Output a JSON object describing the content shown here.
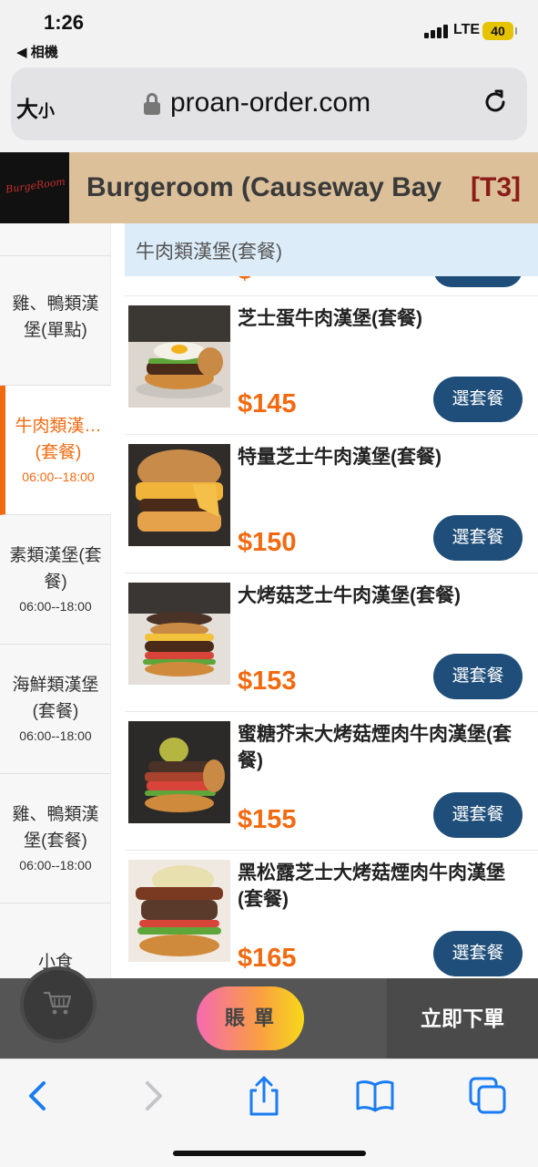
{
  "status_bar": {
    "time": "1:26",
    "back_app": "◀ 相機",
    "network": "LTE",
    "battery": "40"
  },
  "browser": {
    "text_size_label": "大",
    "text_size_label_small": "小",
    "url": "proan-order.com"
  },
  "header": {
    "logo_text": "BurgeRoom",
    "shop_name": "Burgeroom (Causeway Bay",
    "table": "[T3]"
  },
  "sidebar": {
    "items": [
      {
        "name": "雞、鴨類漢堡(單點)",
        "hours": ""
      },
      {
        "name": "牛肉類漢…(套餐)",
        "hours": "06:00--18:00",
        "active": true
      },
      {
        "name": "素類漢堡(套餐)",
        "hours": "06:00--18:00"
      },
      {
        "name": "海鮮類漢堡(套餐)",
        "hours": "06:00--18:00"
      },
      {
        "name": "雞、鴨類漢堡(套餐)",
        "hours": "06:00--18:00"
      },
      {
        "name": "小食",
        "hours": ""
      }
    ]
  },
  "category": {
    "title": "牛肉類漢堡(套餐)"
  },
  "products": [
    {
      "name": "芝士蛋牛肉漢堡(套餐)",
      "price": "$145",
      "button": "選套餐"
    },
    {
      "name": "特量芝士牛肉漢堡(套餐)",
      "price": "$150",
      "button": "選套餐"
    },
    {
      "name": "大烤菇芝士牛肉漢堡(套餐)",
      "price": "$153",
      "button": "選套餐"
    },
    {
      "name": "蜜糖芥末大烤菇煙肉牛肉漢堡(套餐)",
      "price": "$155",
      "button": "選套餐"
    },
    {
      "name": "黑松露芝士大烤菇煙肉牛肉漢堡(套餐)",
      "price": "$165",
      "button": "選套餐"
    }
  ],
  "bottom_bar": {
    "bill": "賬 單",
    "order_now": "立即下單"
  },
  "icons": {
    "cart": "cart-icon",
    "back": "back-icon",
    "forward": "forward-icon",
    "share": "share-icon",
    "bookmarks": "bookmarks-icon",
    "tabs": "tabs-icon",
    "reload": "reload-icon",
    "lock": "lock-icon"
  },
  "colors": {
    "accent": "#f26a10",
    "button": "#1f4e7a",
    "header_bg": "#dcc09a",
    "category_bg": "#dcecf9"
  }
}
